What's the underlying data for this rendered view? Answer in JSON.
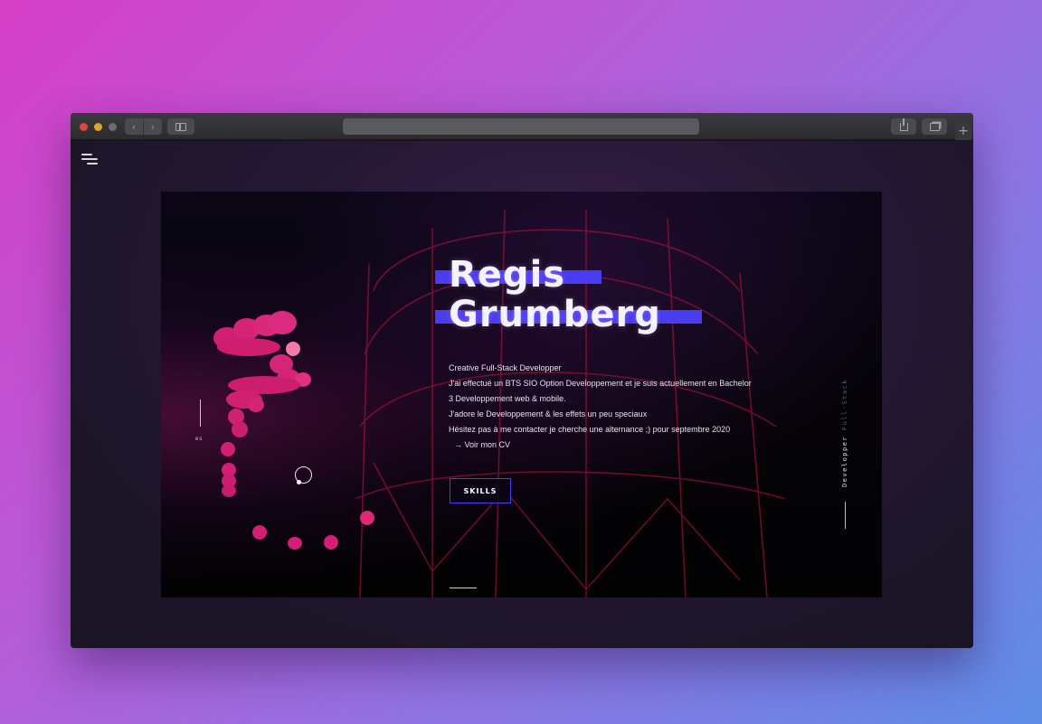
{
  "browser": {
    "back_glyph": "‹",
    "forward_glyph": "›",
    "new_tab_glyph": "+"
  },
  "hero": {
    "first_name": "Regis",
    "last_name": "Grumberg",
    "bio_lines": [
      "Creative Full-Stack Developper",
      "J'ai effectué un BTS SIO Option Developpement et je suis actuellement en Bachelor",
      "3 Developpement web & mobile.",
      "J'adore le Developpement & les effets un peu speciaux",
      "Hésitez pas à me contacter je cherche une alternance ;) pour septembre 2020"
    ],
    "cv_link": "→ Voir mon CV",
    "skills_button": "SKILLS"
  },
  "sidebar": {
    "language": "es",
    "vertical_label_main": "Developper",
    "vertical_label_muted": "Full-Stack"
  },
  "colors": {
    "accent_blue": "#4a3cf0",
    "blob_pink": "#e0207a",
    "link_purple": "#7a4ee0"
  },
  "icons": [
    "hamburger-menu-icon",
    "sidebar-toggle-icon",
    "share-icon",
    "tabs-icon",
    "back-icon",
    "forward-icon"
  ]
}
